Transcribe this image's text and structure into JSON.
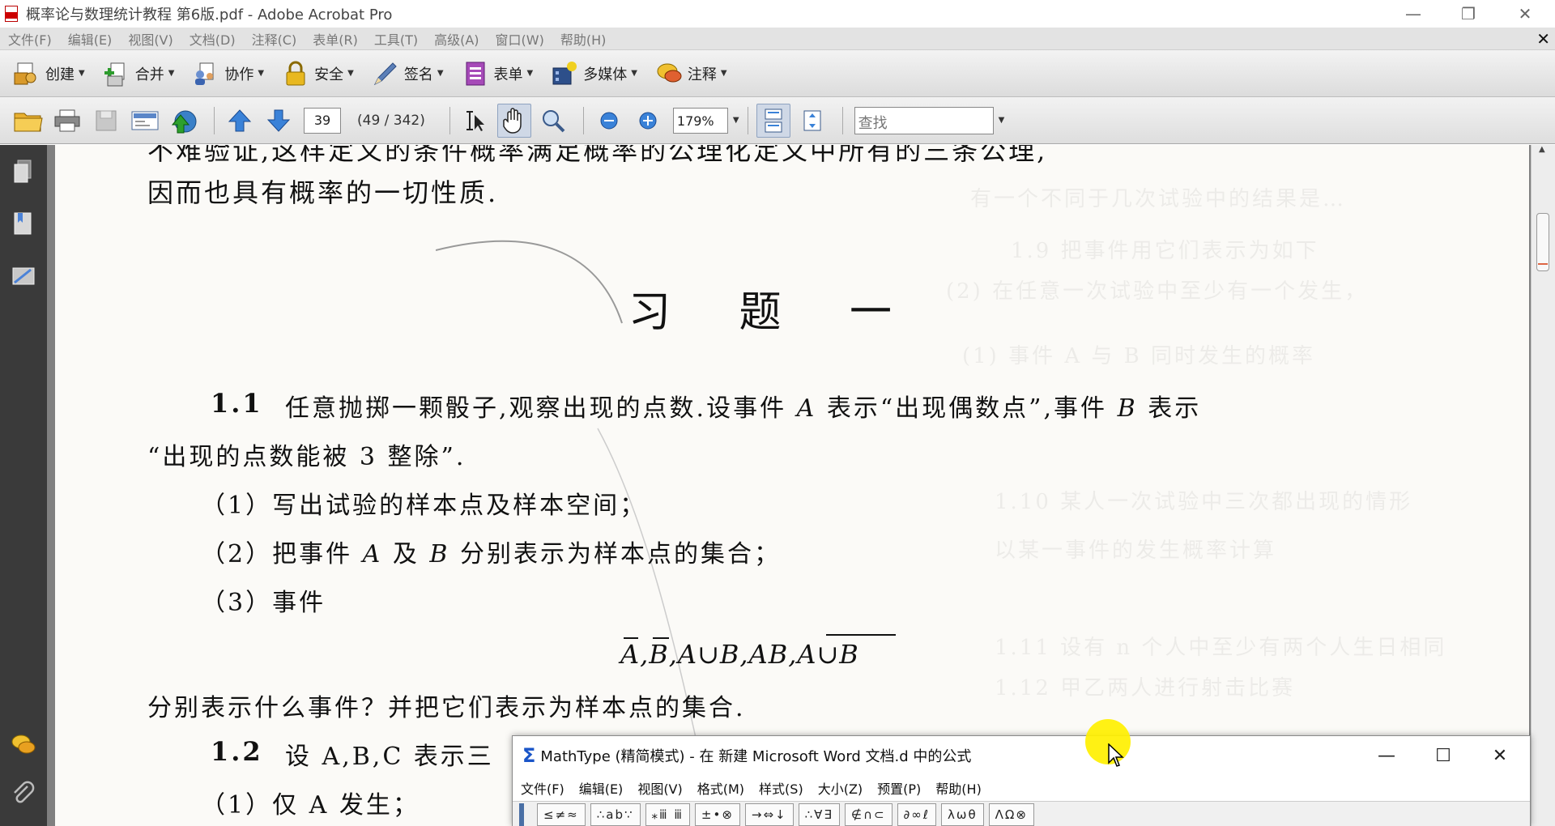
{
  "window": {
    "title": "概率论与数理统计教程 第6版.pdf - Adobe Acrobat Pro",
    "minimize": "—",
    "restore": "❐",
    "close": "✕"
  },
  "menu": {
    "items": [
      "文件(F)",
      "编辑(E)",
      "视图(V)",
      "文档(D)",
      "注释(C)",
      "表单(R)",
      "工具(T)",
      "高级(A)",
      "窗口(W)",
      "帮助(H)"
    ],
    "close_doc": "✕"
  },
  "tasks": [
    {
      "label": "创建",
      "icon": "create-icon"
    },
    {
      "label": "合并",
      "icon": "combine-icon"
    },
    {
      "label": "协作",
      "icon": "collaborate-icon"
    },
    {
      "label": "安全",
      "icon": "lock-icon"
    },
    {
      "label": "签名",
      "icon": "pen-icon"
    },
    {
      "label": "表单",
      "icon": "form-icon"
    },
    {
      "label": "多媒体",
      "icon": "multimedia-icon"
    },
    {
      "label": "注释",
      "icon": "comment-icon"
    }
  ],
  "toolbar": {
    "page_number": "39",
    "page_count": "(49 / 342)",
    "zoom": "179%",
    "find_placeholder": "查找"
  },
  "pdf": {
    "top_fragment": "不难验证,这样定义的条件概率满足概率的公理化定义中所有的三条公理,",
    "line_1": "因而也具有概率的一切性质.",
    "heading": "习 题 一",
    "p11_num": "1.1",
    "p11_text_a": "任意抛掷一颗骰子,观察出现的点数.设事件",
    "p11_A": "A",
    "p11_text_b": "表示“出现偶数点”,事件",
    "p11_B": "B",
    "p11_text_c": "表示",
    "p11_line2": "“出现的点数能被 3 整除”.",
    "q1": "（1）写出试验的样本点及样本空间；",
    "q2_a": "（2）把事件",
    "q2_A": "A",
    "q2_b": "及",
    "q2_B": "B",
    "q2_c": "分别表示为样本点的集合；",
    "q3": "（3）事件",
    "formula": "A,B,A∪B,AB,A∪B",
    "after_formula": "分别表示什么事件？并把它们表示为样本点的集合.",
    "p12_num": "1.2",
    "p12_text": "设 A,B,C 表示三",
    "p12_q1": "（1）仅 A 发生；"
  },
  "mathtype": {
    "title": "MathType (精简模式) - 在 新建 Microsoft Word 文档.d 中的公式",
    "menu": [
      "文件(F)",
      "编辑(E)",
      "视图(V)",
      "格式(M)",
      "样式(S)",
      "大小(Z)",
      "预置(P)",
      "帮助(H)"
    ],
    "palettes": [
      "≤≠≈",
      "∴ab∵",
      "⁎ⅲ ⅲ",
      "±•⊗",
      "→⇔↓",
      "∴∀∃",
      "∉∩⊂",
      "∂∞ℓ",
      "λωθ",
      "ΛΩ⊗"
    ],
    "minimize": "—",
    "maximize": "☐",
    "close": "✕"
  }
}
